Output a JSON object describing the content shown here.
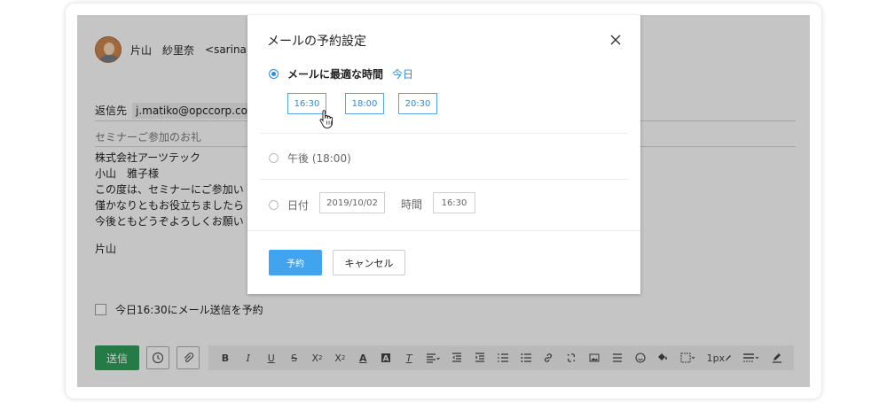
{
  "compose": {
    "from_name": "片山　紗里奈",
    "from_email": "<sarina.k",
    "reply_label": "返信先",
    "reply_value": "j.matiko@opccorp.co",
    "subject_placeholder": "セミナーご参加のお礼",
    "body": {
      "line1": "株式会社アーツテック",
      "line2": "小山　雅子様",
      "line3": "この度は、セミナーにご参加い",
      "line4": "僅かなりともお役立ちましたら",
      "line5": "今後ともどうぞよろしくお願い",
      "signature": "片山"
    },
    "schedule_checkbox_label": "今日16:30にメール送信を予約",
    "send_label": "送信",
    "size_label": "1px"
  },
  "modal": {
    "title": "メールの予約設定",
    "option1_label": "メールに最適な時間",
    "option1_today": "今日",
    "time_options": [
      "16:30",
      "18:00",
      "20:30"
    ],
    "option2_label": "午後 (18:00)",
    "option3_label": "日付",
    "date_value": "2019/10/02",
    "time_label": "時間",
    "time_value": "16:30",
    "reserve_label": "予約",
    "cancel_label": "キャンセル"
  },
  "colors": {
    "accent": "#2b8de0",
    "send_green": "#2e9a57",
    "reserve_blue": "#42a4ef"
  }
}
